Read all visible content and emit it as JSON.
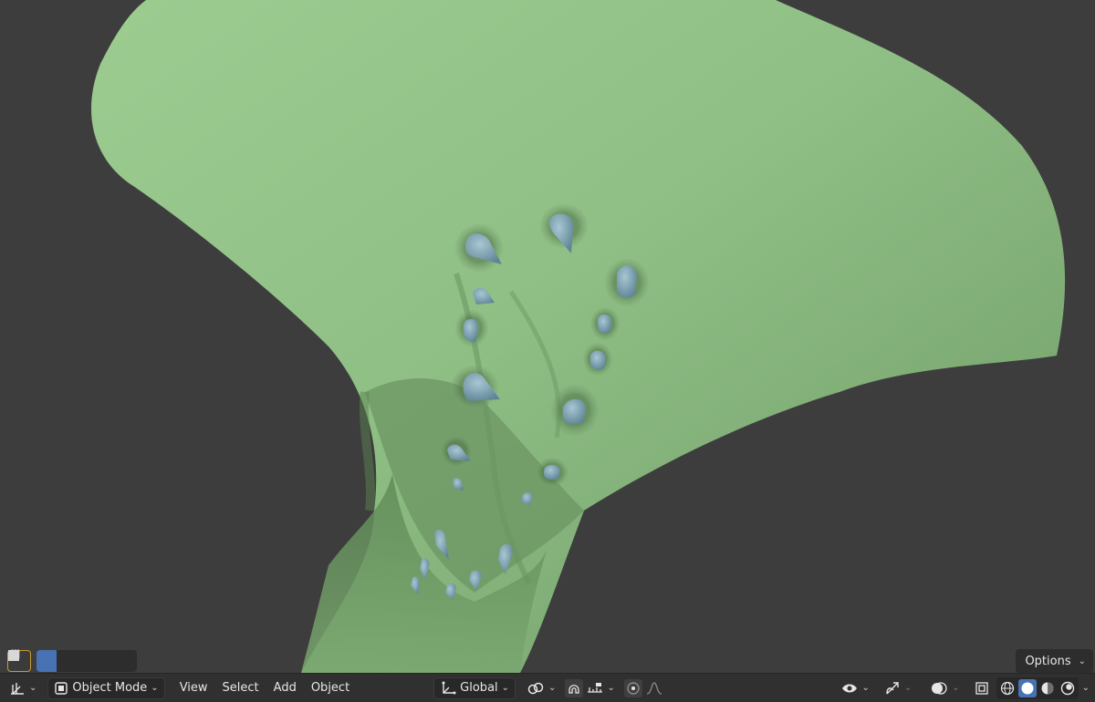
{
  "header": {
    "mode_label": "Object Mode",
    "menus": [
      "View",
      "Select",
      "Add",
      "Object"
    ],
    "orientation_label": "Global"
  },
  "overlay": {
    "options_label": "Options"
  },
  "icons": {
    "editor_type": "axis-grid-icon",
    "object_mode": "object-cube-icon",
    "transform_orientation": "axes-icon",
    "pivot": "link-icon",
    "snap": "magnet-icon",
    "snap_target": "ruler-icon",
    "proportional": "proportional-dot-icon",
    "falloff": "falloff-curve-icon",
    "visibility": "eye-icon",
    "gizmo": "gizmo-arrows-icon",
    "overlays": "overlay-circles-icon",
    "xray": "xray-square-icon",
    "shading": [
      "wireframe-shading-icon",
      "solid-shading-icon",
      "material-shading-icon",
      "rendered-shading-icon"
    ]
  },
  "colors": {
    "mesh_green": "#8fbf85",
    "spike_blue": "#7fa3b4",
    "viewport_bg": "#3d3d3d",
    "header_bg": "#303030",
    "accent_blue": "#4772b3"
  }
}
